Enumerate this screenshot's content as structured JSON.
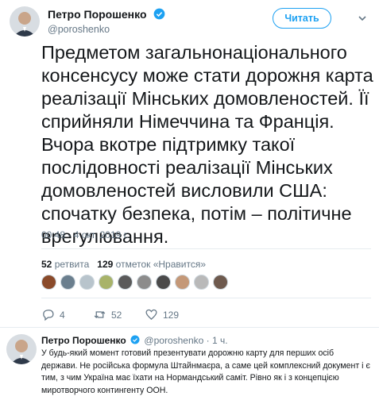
{
  "tweet": {
    "author_name": "Петро Порошенко",
    "author_handle": "@poroshenko",
    "follow_label": "Читать",
    "text": "Предметом загальнонаціонального консенсусу може стати дорожня карта реалізації Мінських домовленостей. Її сприйняли Німеччина та Франція. Вчора вкотре підтримку такої послідовності реалізації Мінських домовленостей висловили США: спочатку безпека, потім – політичне врегулювання.",
    "timestamp": "00:48 - 4 окт. 2019 г.",
    "stats": {
      "retweets_count": "52",
      "retweets_label": "ретвита",
      "likes_count": "129",
      "likes_label": "отметок «Нравится»"
    },
    "liker_avatars": [
      "#8a4a2a",
      "#6b7f8e",
      "#b8c4cc",
      "#a8b36a",
      "#5a5a5a",
      "#8c8c8c",
      "#4a4a4a",
      "#c49878",
      "#b9b9b9",
      "#6e5a4e"
    ],
    "actions": {
      "reply_count": "4",
      "retweet_count": "52",
      "like_count": "129"
    }
  },
  "reply": {
    "author_name": "Петро Порошенко",
    "verified_handle_time": "@poroshenko · 1 ч.",
    "text": "У будь-який момент готовий презентувати дорожню карту для перших осіб держави. Не російська формула Штайнмаєра, а саме цей комплексний документ і є тим, з чим Україна має їхати на Нормандський саміт. Рівно як і з концепцією миротворчого контингенту ООН."
  },
  "colors": {
    "accent": "#1da1f2",
    "secondary_text": "#657786",
    "divider": "#e6ecf0"
  },
  "icons": [
    "verified-icon",
    "chevron-down-icon",
    "reply-icon",
    "retweet-icon",
    "like-icon"
  ]
}
